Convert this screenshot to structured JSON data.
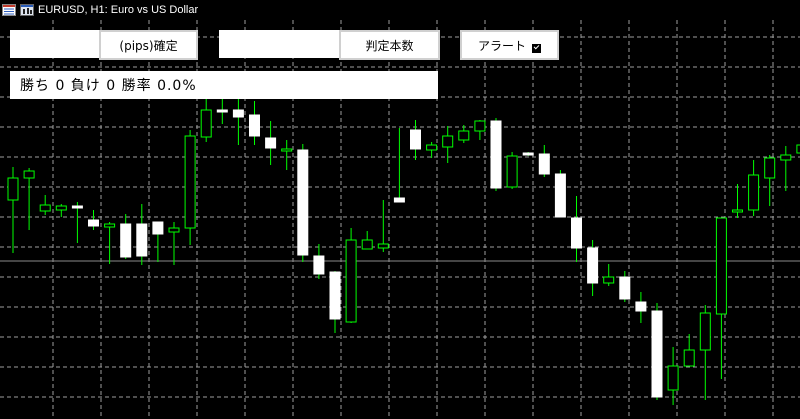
{
  "window": {
    "title": "EURUSD, H1:  Euro vs US Dollar"
  },
  "controls": {
    "pips_input": "",
    "pips_button": "(pips)確定",
    "judge_input": "",
    "judge_button": "判定本数",
    "alert_button": "アラート",
    "alert_checked": true
  },
  "stats": {
    "text": "勝ち  0  負け  0  勝率  0.0%"
  },
  "colors": {
    "background": "#000000",
    "grid": "#9e9e9e",
    "bull": "#00ff00",
    "bear_body": "#ffffff",
    "bear_wick": "#00ff00"
  },
  "chart_data": {
    "type": "candlestick",
    "symbol": "EURUSD",
    "timeframe": "H1",
    "candles": [
      [
        200,
        167,
        253,
        178
      ],
      [
        178,
        168,
        230,
        171
      ],
      [
        211,
        195,
        215,
        205
      ],
      [
        210,
        204,
        217,
        206
      ],
      [
        206,
        202,
        243,
        206
      ],
      [
        220,
        210,
        230,
        226
      ],
      [
        227,
        222,
        264,
        224
      ],
      [
        224,
        214,
        259,
        257
      ],
      [
        224,
        204,
        265,
        256
      ],
      [
        222,
        223,
        262,
        234
      ],
      [
        232,
        222,
        265,
        228
      ],
      [
        228,
        130,
        245,
        136
      ],
      [
        137,
        97,
        142,
        110
      ],
      [
        110,
        95,
        124,
        110
      ],
      [
        110,
        77,
        145,
        117
      ],
      [
        115,
        101,
        145,
        136
      ],
      [
        138,
        121,
        165,
        148
      ],
      [
        150,
        140,
        170,
        149
      ],
      [
        150,
        144,
        262,
        255
      ],
      [
        256,
        244,
        279,
        274
      ],
      [
        272,
        271,
        333,
        319
      ],
      [
        322,
        228,
        323,
        240
      ],
      [
        249,
        231,
        249,
        240
      ],
      [
        248,
        200,
        252,
        244
      ],
      [
        198,
        128,
        200,
        202
      ],
      [
        130,
        120,
        160,
        149
      ],
      [
        150,
        142,
        158,
        145
      ],
      [
        147,
        126,
        163,
        136
      ],
      [
        140,
        125,
        143,
        131
      ],
      [
        131,
        120,
        140,
        121
      ],
      [
        121,
        118,
        191,
        188
      ],
      [
        187,
        152,
        189,
        156
      ],
      [
        153,
        152,
        156,
        155
      ],
      [
        154,
        145,
        177,
        174
      ],
      [
        174,
        170,
        206,
        217
      ],
      [
        218,
        196,
        262,
        248
      ],
      [
        248,
        240,
        296,
        283
      ],
      [
        283,
        264,
        286,
        277
      ],
      [
        277,
        271,
        302,
        299
      ],
      [
        302,
        292,
        323,
        311
      ],
      [
        311,
        303,
        400,
        397
      ],
      [
        390,
        347,
        405,
        366
      ],
      [
        366,
        334,
        365,
        350
      ],
      [
        350,
        305,
        400,
        313
      ],
      [
        314,
        244,
        379,
        218
      ],
      [
        212,
        184,
        218,
        210
      ],
      [
        210,
        160,
        216,
        175
      ],
      [
        178,
        155,
        206,
        158
      ],
      [
        160,
        146,
        191,
        155
      ],
      [
        153,
        139,
        159,
        145
      ],
      [
        145,
        140,
        173,
        170
      ],
      [
        170,
        152,
        192,
        175
      ],
      [
        175,
        150,
        182,
        167
      ],
      [
        162,
        154,
        172,
        158
      ],
      [
        160,
        155,
        164,
        159
      ],
      [
        195,
        183,
        218,
        189
      ],
      [
        189,
        179,
        201,
        190
      ]
    ]
  }
}
